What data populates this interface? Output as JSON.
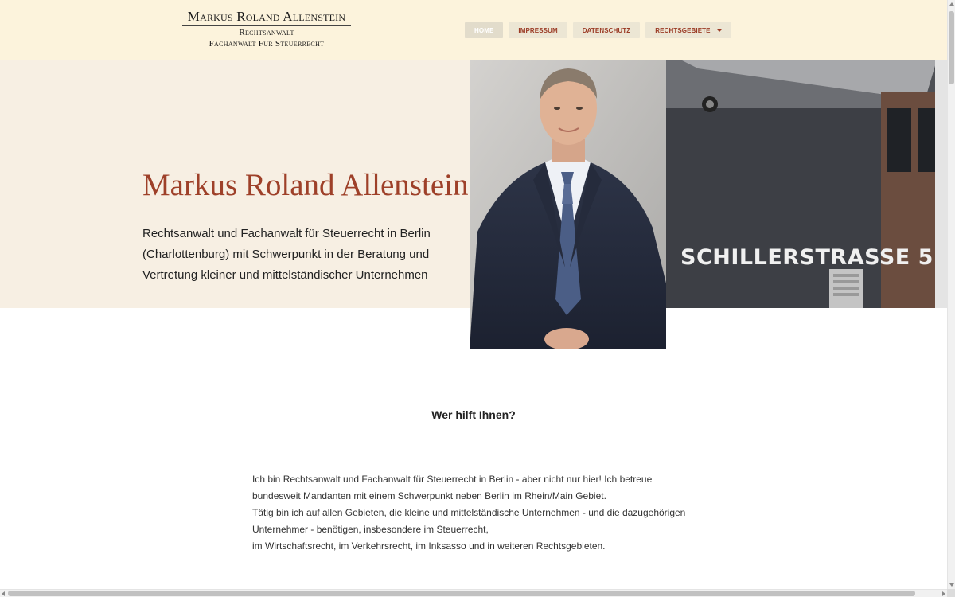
{
  "logo": {
    "line1": "Markus Roland Allenstein",
    "line2": "Rechtsanwalt",
    "line3": "Fachanwalt Für Steuerrecht"
  },
  "nav": {
    "items": [
      {
        "label": "HOME",
        "active": true
      },
      {
        "label": "IMPRESSUM",
        "active": false
      },
      {
        "label": "DATENSCHUTZ",
        "active": false
      },
      {
        "label": "RECHTSGEBIETE",
        "active": false,
        "dropdown": true
      }
    ]
  },
  "hero": {
    "title": "Markus Roland Allenstein",
    "text": "Rechtsanwalt und Fachanwalt für Steuerrecht in Berlin (Charlottenburg) mit Schwerpunkt in der Beratung und Vertretung kleiner und mittelständischer Unternehmen",
    "building_sign": "SCHILLERSTRASSE 5"
  },
  "content": {
    "section_title": "Wer hilft Ihnen?",
    "paragraphs": [
      "Ich bin Rechtsanwalt und Fachanwalt für Steuerrecht in Berlin - aber nicht nur hier! Ich betreue bundesweit Mandanten mit einem Schwerpunkt neben Berlin im Rhein/Main Gebiet.",
      "Tätig bin ich auf allen Gebieten, die kleine und mittelständische Unternehmen - und die dazugehörigen Unternehmer - benötigen, insbesondere im Steuerrecht,",
      "im Wirtschaftsrecht, im Verkehrsrecht, im Inksasso und in weiteren Rechtsgebieten."
    ]
  },
  "colors": {
    "header_bg": "#fcf3dc",
    "hero_bg": "#f7efe3",
    "accent": "#9e4029",
    "nav_bg": "#ece6d4"
  }
}
